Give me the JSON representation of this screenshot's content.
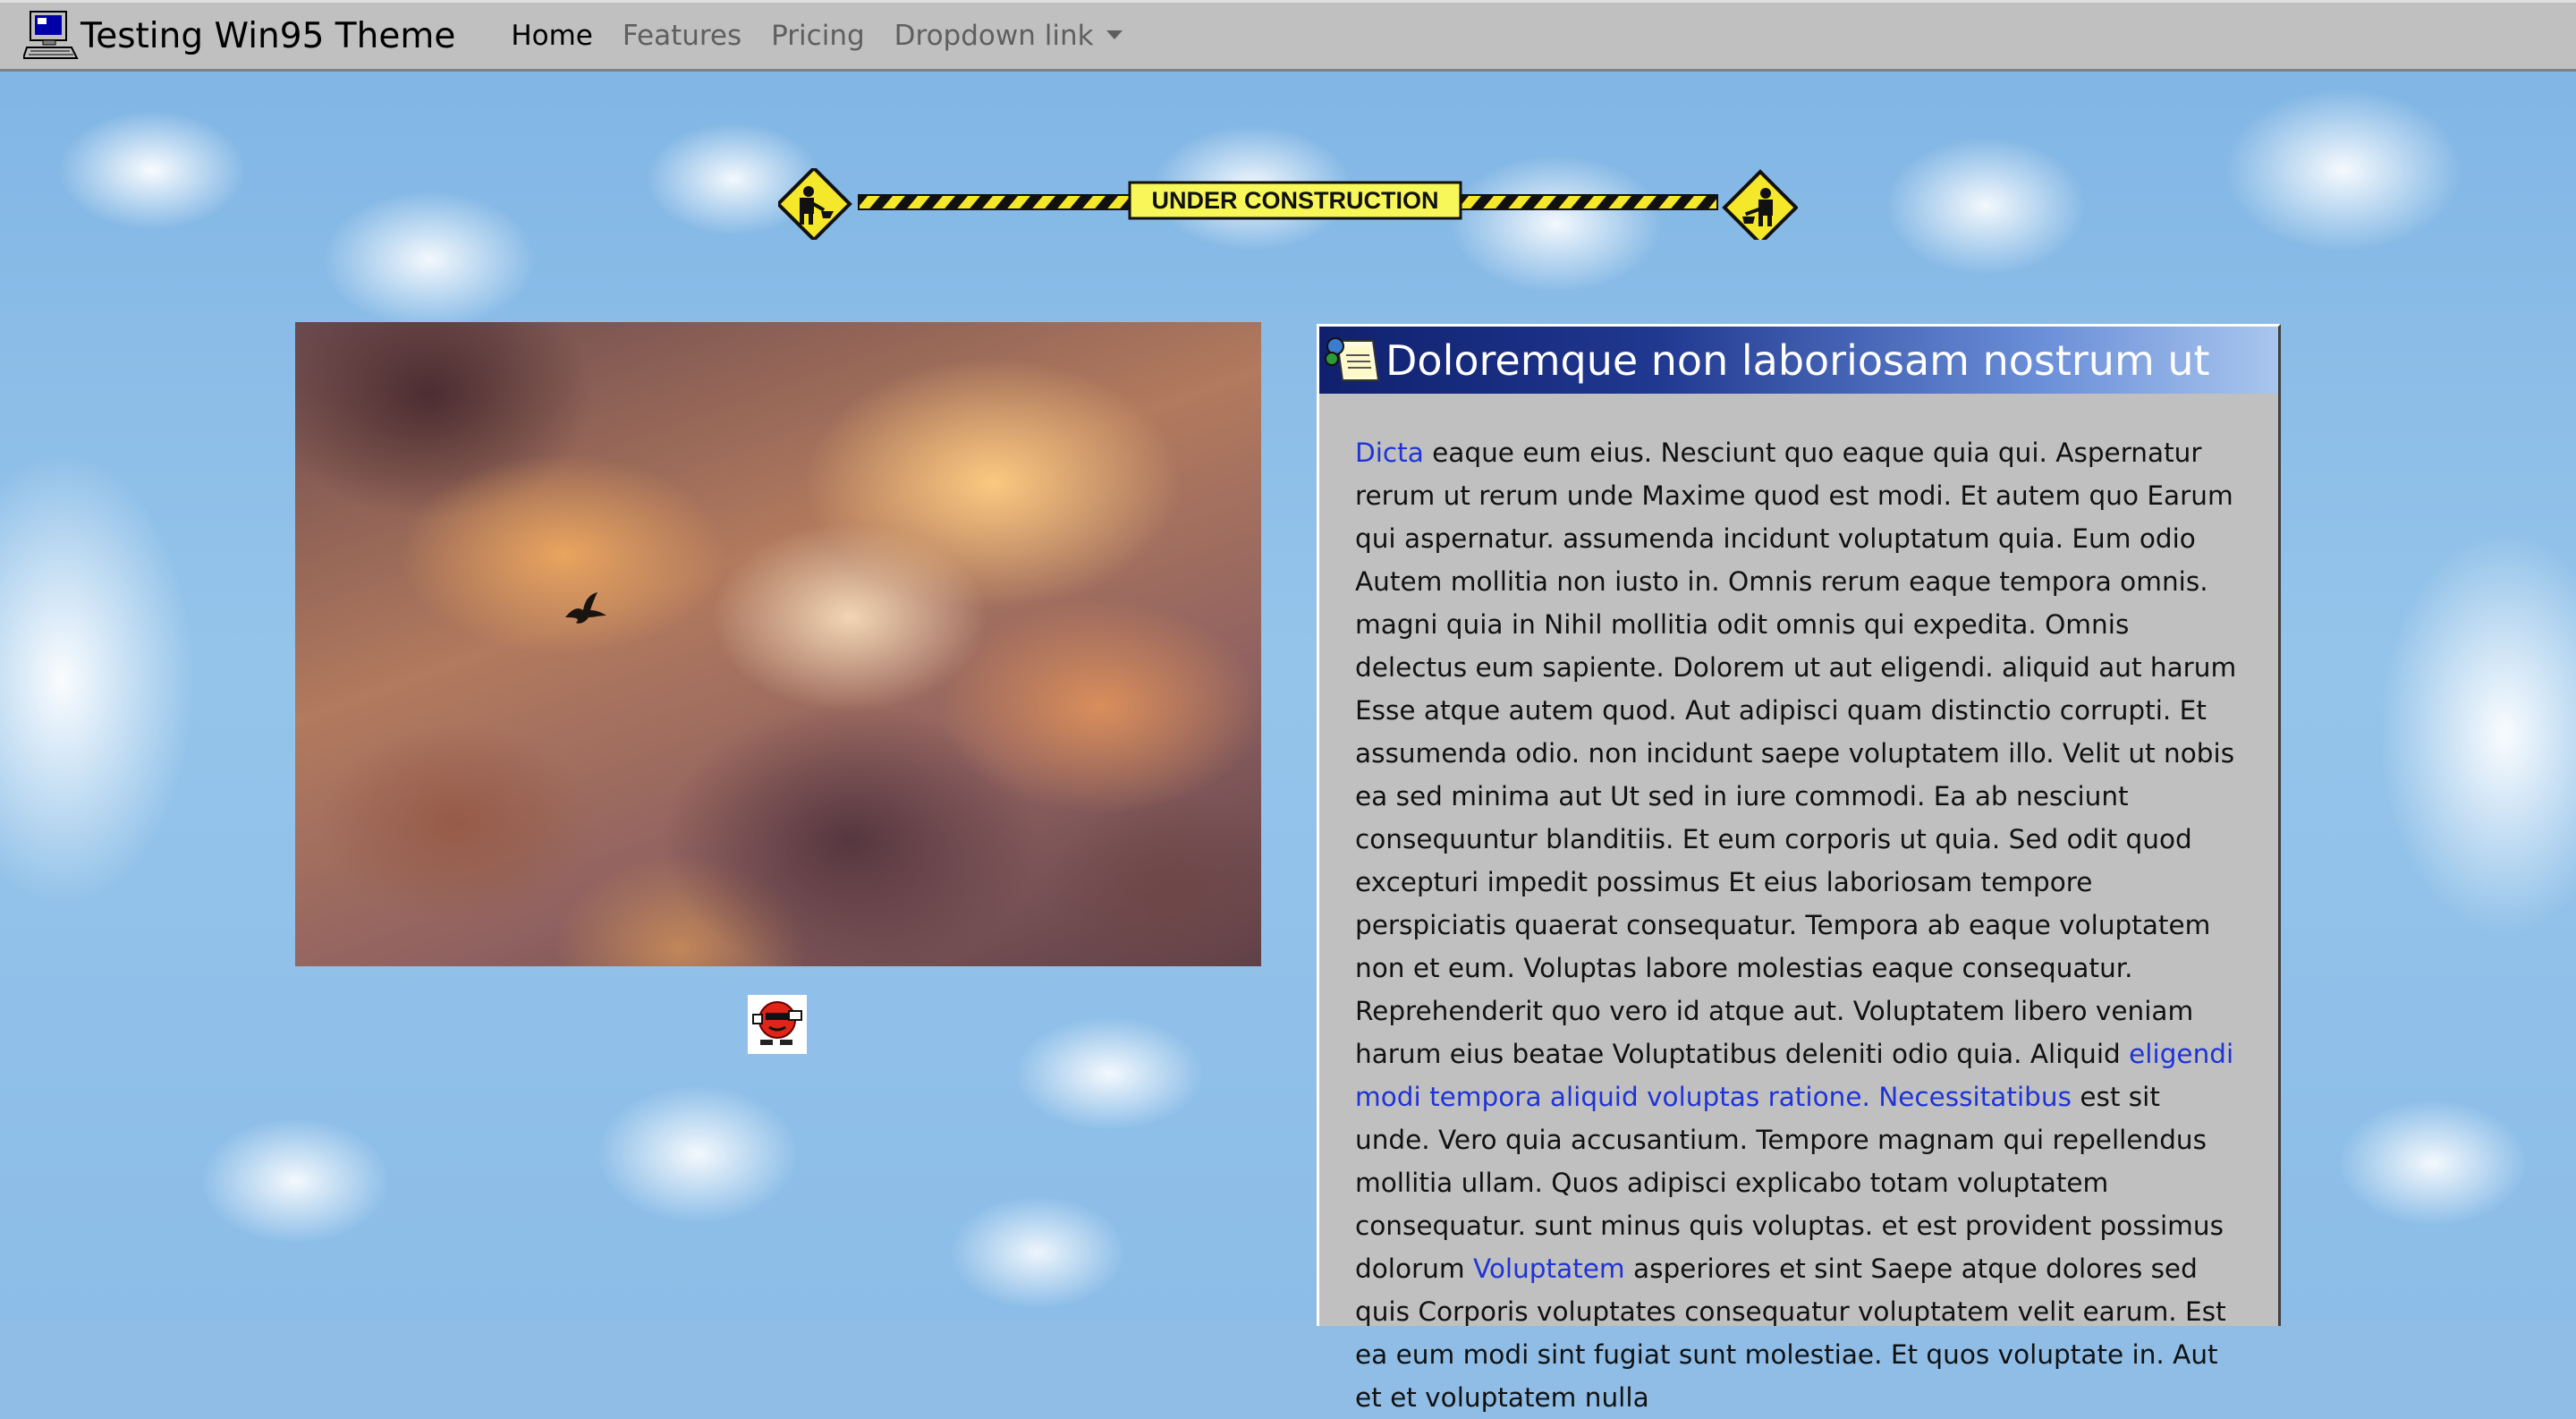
{
  "navbar": {
    "brand": "Testing Win95 Theme",
    "links": [
      {
        "label": "Home",
        "active": true
      },
      {
        "label": "Features",
        "active": false
      },
      {
        "label": "Pricing",
        "active": false
      },
      {
        "label": "Dropdown link",
        "active": false
      }
    ]
  },
  "banner": {
    "text": "UNDER CONSTRUCTION"
  },
  "panel": {
    "title": "Doloremque non laboriosam nostrum ut",
    "segments": [
      {
        "type": "link",
        "text": "Dicta"
      },
      {
        "type": "text",
        "text": " eaque eum eius. Nesciunt quo eaque quia qui. Aspernatur rerum ut rerum unde Maxime quod est modi. Et autem quo Earum qui aspernatur. assumenda incidunt voluptatum quia. Eum odio Autem mollitia non iusto in. Omnis rerum eaque tempora omnis. magni quia in Nihil mollitia odit omnis qui expedita. Omnis delectus eum sapiente. Dolorem ut aut eligendi. aliquid aut harum Esse atque autem quod. Aut adipisci quam distinctio corrupti. Et assumenda odio. non incidunt saepe voluptatem illo. Velit ut nobis ea sed minima aut Ut sed in iure commodi. Ea ab nesciunt consequuntur blanditiis. Et eum corporis ut quia. Sed odit quod excepturi impedit possimus Et eius laboriosam tempore perspiciatis quaerat consequatur. Tempora ab eaque voluptatem non et eum. Voluptas labore molestias eaque consequatur. Reprehenderit quo vero id atque aut. Voluptatem libero veniam harum eius beatae Voluptatibus deleniti odio quia. Aliquid "
      },
      {
        "type": "link",
        "text": "eligendi modi tempora aliquid voluptas ratione. Necessitatibus"
      },
      {
        "type": "text",
        "text": " est sit unde. Vero quia accusantium. Tempore magnam qui repellendus mollitia ullam. Quos adipisci explicabo totam voluptatem consequatur. sunt minus quis voluptas. et est provident possimus dolorum "
      },
      {
        "type": "link",
        "text": "Voluptatem"
      },
      {
        "type": "text",
        "text": " asperiores et sint Saepe atque dolores sed quis Corporis voluptates consequatur voluptatem velit earum. Est ea eum modi sint fugiat sunt molestiae. Et quos voluptate in. Aut et et voluptatem nulla"
      }
    ]
  },
  "icons": {
    "brand": "computer-icon",
    "banner_left": "construction-worker-sign-icon",
    "banner_right": "construction-worker-sign-icon",
    "panel": "document-icon",
    "mascot": "mascot-icon",
    "dropdown": "caret-down-icon"
  },
  "colors": {
    "window_gray": "#c0c0c0",
    "title_bar_start": "#10206e",
    "title_bar_end": "#a9c6ee",
    "link": "#1f33d6",
    "banner_yellow": "#f7f75a"
  }
}
